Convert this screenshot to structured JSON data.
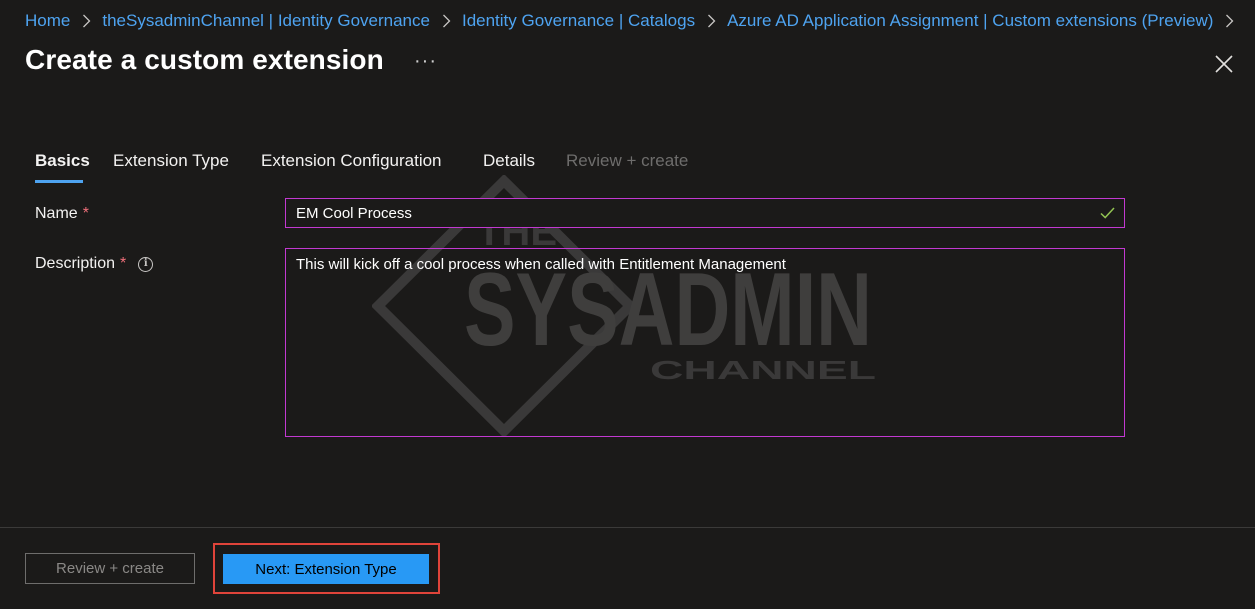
{
  "breadcrumb": [
    "Home",
    "theSysadminChannel | Identity Governance",
    "Identity Governance | Catalogs",
    "Azure AD Application Assignment | Custom extensions (Preview)"
  ],
  "page": {
    "title": "Create a custom extension",
    "more_label": "···"
  },
  "tabs": [
    {
      "label": "Basics",
      "state": "active"
    },
    {
      "label": "Extension Type",
      "state": "enabled"
    },
    {
      "label": "Extension Configuration",
      "state": "enabled"
    },
    {
      "label": "Details",
      "state": "enabled"
    },
    {
      "label": "Review + create",
      "state": "disabled"
    }
  ],
  "form": {
    "name": {
      "label": "Name",
      "required_mark": "*",
      "value": "EM Cool Process",
      "valid": true
    },
    "description": {
      "label": "Description",
      "required_mark": "*",
      "value": "This will kick off a cool process when called with Entitlement Management",
      "info_icon": "info-icon"
    }
  },
  "watermark": {
    "line1": "THE",
    "line2": "SYSADMIN",
    "line3": "CHANNEL"
  },
  "footer": {
    "review_create_label": "Review + create",
    "next_label": "Next: Extension Type"
  },
  "colors": {
    "link": "#4ea3f0",
    "accent": "#2899f5",
    "input_border": "#c239d1",
    "highlight": "#e0443a",
    "background": "#1b1a19"
  }
}
